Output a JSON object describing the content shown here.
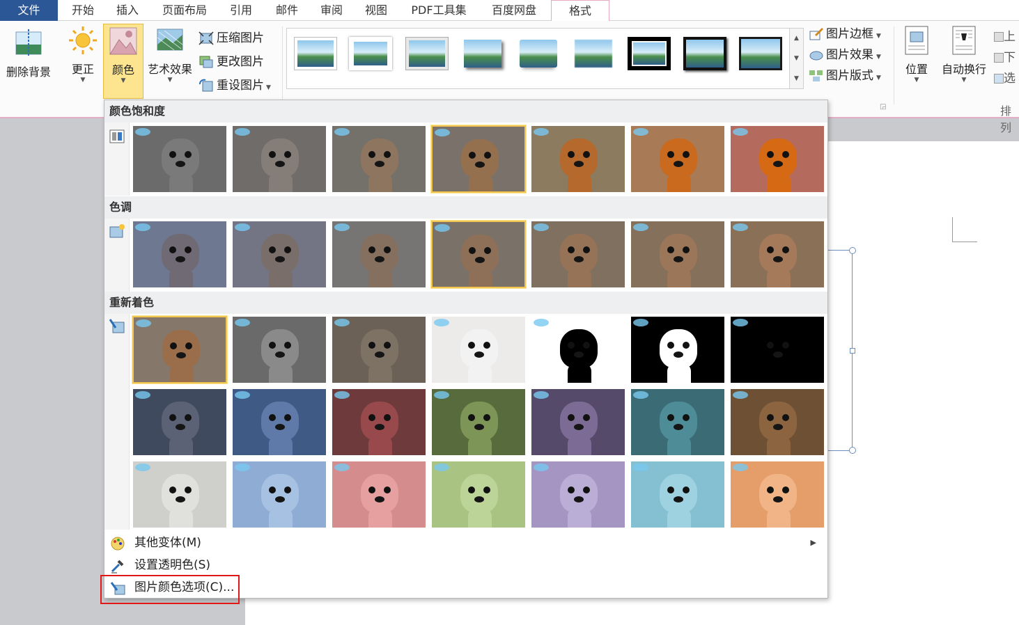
{
  "tabs": {
    "file": "文件",
    "home": "开始",
    "insert": "插入",
    "layout": "页面布局",
    "references": "引用",
    "mailings": "邮件",
    "review": "审阅",
    "view": "视图",
    "pdf": "PDF工具集",
    "baidu": "百度网盘",
    "format": "格式"
  },
  "ribbon": {
    "remove_background": "删除背景",
    "corrections": "更正",
    "color": "颜色",
    "artistic_effects": "艺术效果",
    "compress": "压缩图片",
    "change_picture": "更改图片",
    "reset_picture": "重设图片",
    "picture_border": "图片边框",
    "picture_effects": "图片效果",
    "picture_layout": "图片版式",
    "position": "位置",
    "wrap_text": "自动换行",
    "bring_forward": "上",
    "send_backward": "下",
    "selection": "选",
    "arrange_group": "排列"
  },
  "dropdown": {
    "saturation": {
      "title": "颜色饱和度",
      "items": [
        {
          "fur": "#7a7a7a",
          "bg": "#6b6b6b"
        },
        {
          "fur": "#857d77",
          "bg": "#706c69"
        },
        {
          "fur": "#8d7560",
          "bg": "#74706a"
        },
        {
          "fur": "#94704f",
          "bg": "#7a726a"
        },
        {
          "fur": "#b5692c",
          "bg": "#8c7b5e"
        },
        {
          "fur": "#c96a1e",
          "bg": "#a87a55"
        },
        {
          "fur": "#d66a14",
          "bg": "#b56a5e"
        }
      ],
      "selected": 3
    },
    "tone": {
      "title": "色调",
      "items": [
        {
          "fur": "#6f6a74",
          "bg": "#6e7890"
        },
        {
          "fur": "#7a6e6a",
          "bg": "#737585"
        },
        {
          "fur": "#85705f",
          "bg": "#777474"
        },
        {
          "fur": "#8e7058",
          "bg": "#7a7169"
        },
        {
          "fur": "#967357",
          "bg": "#80705f"
        },
        {
          "fur": "#9c7658",
          "bg": "#85705c"
        },
        {
          "fur": "#a57a5a",
          "bg": "#8b7058"
        }
      ],
      "selected": 3
    },
    "recolor": {
      "title": "重新着色",
      "rows": [
        [
          {
            "fur": "#9a6e4b",
            "bg": "#857769"
          },
          {
            "fur": "#8a8a8a",
            "bg": "#6a6a6a"
          },
          {
            "fur": "#7e7265",
            "bg": "#6b6157"
          },
          {
            "fur": "#f2f2f2",
            "bg": "#ecebea"
          },
          {
            "fur": "#000000",
            "bg": "#ffffff"
          },
          {
            "fur": "#ffffff",
            "bg": "#000000"
          },
          {
            "fur": "#000000",
            "bg": "#000000"
          }
        ],
        [
          {
            "fur": "#5c6275",
            "bg": "#3f4a5e"
          },
          {
            "fur": "#5f7aa8",
            "bg": "#3e5a85"
          },
          {
            "fur": "#98494c",
            "bg": "#6e3a3c"
          },
          {
            "fur": "#7d9556",
            "bg": "#586b3c"
          },
          {
            "fur": "#7b6b95",
            "bg": "#564a6a"
          },
          {
            "fur": "#4e8c98",
            "bg": "#3b6c76"
          },
          {
            "fur": "#8c6440",
            "bg": "#6e5034"
          }
        ],
        [
          {
            "fur": "#e0e0dc",
            "bg": "#cfcfcb"
          },
          {
            "fur": "#a6c1e2",
            "bg": "#8fadd4"
          },
          {
            "fur": "#e6a0a0",
            "bg": "#d48c8c"
          },
          {
            "fur": "#bcd498",
            "bg": "#a8c382"
          },
          {
            "fur": "#baaed6",
            "bg": "#a595c2"
          },
          {
            "fur": "#9ed2e0",
            "bg": "#84c0d2"
          },
          {
            "fur": "#f0b486",
            "bg": "#e59e6a"
          }
        ]
      ],
      "selected": 0
    },
    "more_variations": "其他变体(M)",
    "set_transparent": "设置透明色(S)",
    "color_options": "图片颜色选项(C)..."
  },
  "colors": {
    "file_tab": "#2b5797",
    "format_tab_border": "#e9a8c2",
    "selected_button": "#fde58f",
    "selected_thumb_border": "#f2c450",
    "callout_red": "#e01818"
  }
}
